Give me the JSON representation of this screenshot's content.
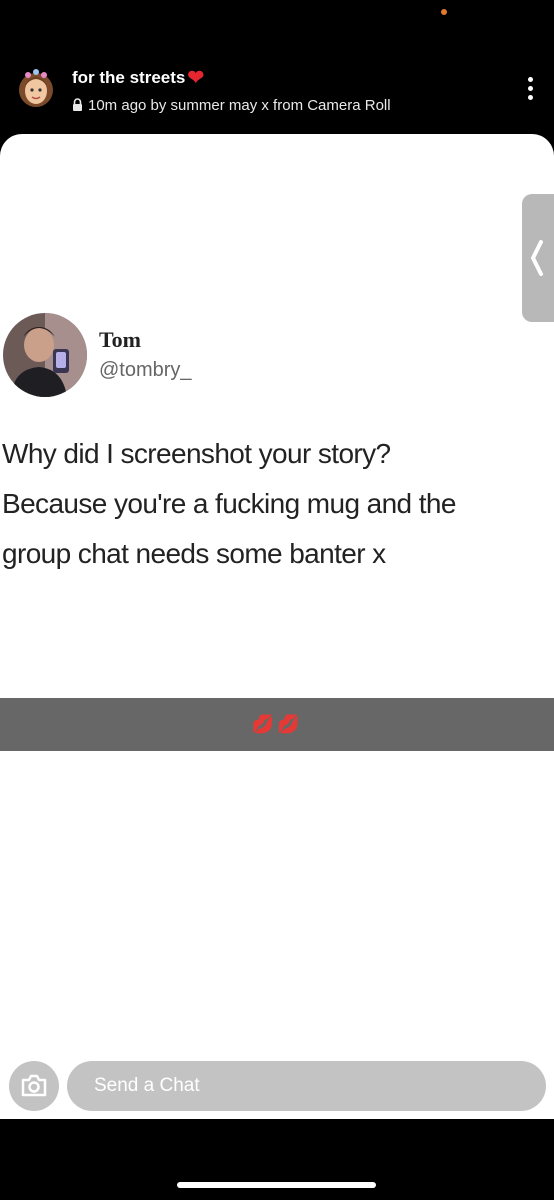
{
  "header": {
    "title": "for the streets",
    "subtitle": "10m ago by summer may x from Camera Roll",
    "icons": {
      "avatar": "bitmoji-avatar",
      "heart": "red-heart-emoji",
      "lock": "lock-icon",
      "more": "more-vertical-icon"
    }
  },
  "story": {
    "tweet": {
      "name": "Tom",
      "handle": "@tombry_",
      "lines": [
        "Why did I screenshot your story?",
        "Because you're a fucking mug and the",
        "group chat needs some banter x"
      ]
    },
    "caption": "💋💋"
  },
  "footer": {
    "chat_placeholder": "Send a Chat",
    "icons": {
      "camera": "camera-icon"
    }
  },
  "colors": {
    "background": "#000000",
    "card": "#ffffff",
    "caption_bar": "#676767",
    "input": "#c3c3c3",
    "heart": "#e3262f"
  }
}
